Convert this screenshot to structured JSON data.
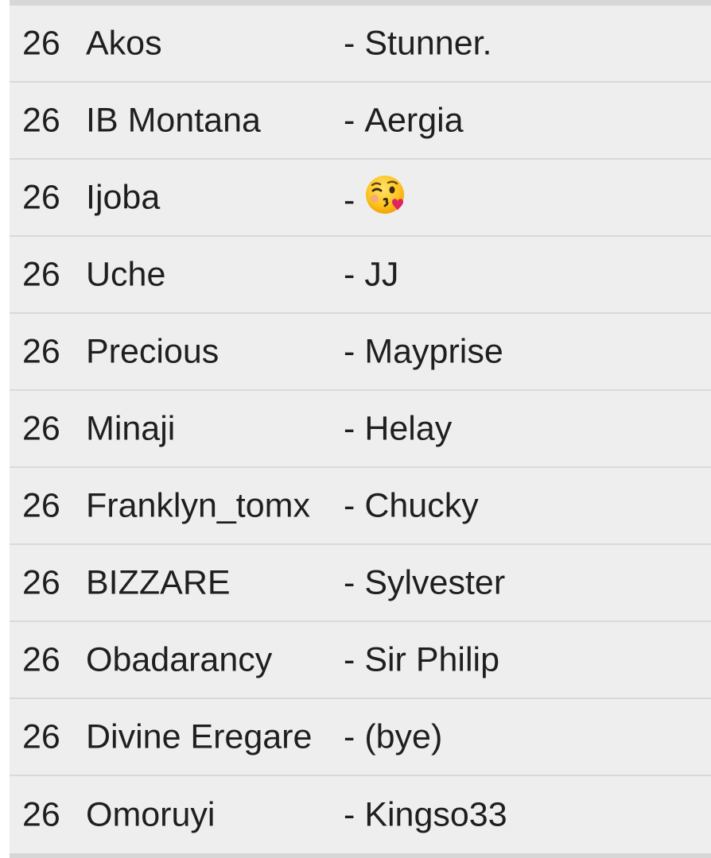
{
  "rows": [
    {
      "number": "26",
      "name": "Akos",
      "partner": "Stunner."
    },
    {
      "number": "26",
      "name": "IB Montana",
      "partner": "Aergia"
    },
    {
      "number": "26",
      "name": "Ijoba",
      "partner": "",
      "partner_icon": "kissing-face-heart-emoji"
    },
    {
      "number": "26",
      "name": "Uche",
      "partner": "JJ"
    },
    {
      "number": "26",
      "name": "Precious",
      "partner": "Mayprise"
    },
    {
      "number": "26",
      "name": "Minaji",
      "partner": "Helay"
    },
    {
      "number": "26",
      "name": "Franklyn_tomx",
      "partner": "Chucky"
    },
    {
      "number": "26",
      "name": "BIZZARE",
      "partner": "Sylvester"
    },
    {
      "number": "26",
      "name": "Obadarancy",
      "partner": "Sir Philip"
    },
    {
      "number": "26",
      "name": "Divine Eregare",
      "partner": "(bye)"
    },
    {
      "number": "26",
      "name": "Omoruyi",
      "partner": "Kingso33"
    }
  ],
  "separator": "-",
  "colors": {
    "row_background": "#eeeeee",
    "divider": "#d9d9d9",
    "edge": "#d7d7d7",
    "text": "#1f1f1f"
  }
}
